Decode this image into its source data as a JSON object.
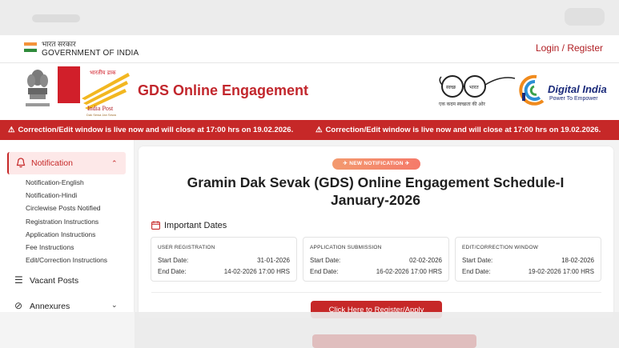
{
  "gov": {
    "hindi": "भारत सरकार",
    "english": "GOVERNMENT OF INDIA",
    "login_label": "Login / Register"
  },
  "header": {
    "title": "GDS Online Engagement",
    "india_post_text": "India Post",
    "india_post_tagline": "Dak Sewa Jan Sewa",
    "swachh_caption": "एक कदम स्वच्छता की ओर",
    "digital_india_title": "Digital India",
    "digital_india_sub": "Power To Empower"
  },
  "alert": {
    "messages": [
      "Correction/Edit window is live now and will close at 17:00 hrs on 19.02.2026.",
      "Correction/Edit window is live now and will close at 17:00 hrs on 19.02.2026."
    ]
  },
  "sidebar": {
    "active_label": "Notification",
    "sublinks": [
      "Notification-English",
      "Notification-Hindi",
      "Circlewise Posts Notified",
      "Registration Instructions",
      "Application Instructions",
      "Fee Instructions",
      "Edit/Correction Instructions"
    ],
    "items": [
      {
        "label": "Vacant Posts",
        "icon": "list-check-icon"
      },
      {
        "label": "Annexures",
        "icon": "paperclip-icon"
      }
    ]
  },
  "main": {
    "badge": "✈ NEW NOTIFICATION ✈",
    "headline_line1": "Gramin Dak Sevak (GDS) Online Engagement Schedule-I",
    "headline_line2": "January-2026",
    "dates_title": "Important Dates",
    "date_boxes": [
      {
        "title": "USER REGISTRATION",
        "start_label": "Start Date:",
        "start": "31-01-2026",
        "end_label": "End Date:",
        "end": "14-02-2026 17:00 HRS"
      },
      {
        "title": "APPLICATION SUBMISSION",
        "start_label": "Start Date:",
        "start": "02-02-2026",
        "end_label": "End Date:",
        "end": "16-02-2026 17:00 HRS"
      },
      {
        "title": "EDIT/CORRECTION WINDOW",
        "start_label": "Start Date:",
        "start": "18-02-2026",
        "end_label": "End Date:",
        "end": "19-02-2026 17:00 HRS"
      }
    ],
    "register_button": "Click Here to Register/Apply"
  },
  "colors": {
    "brand_red": "#c62828",
    "title_red": "#c2272d",
    "digital_india_blue": "#1a2a7a"
  }
}
